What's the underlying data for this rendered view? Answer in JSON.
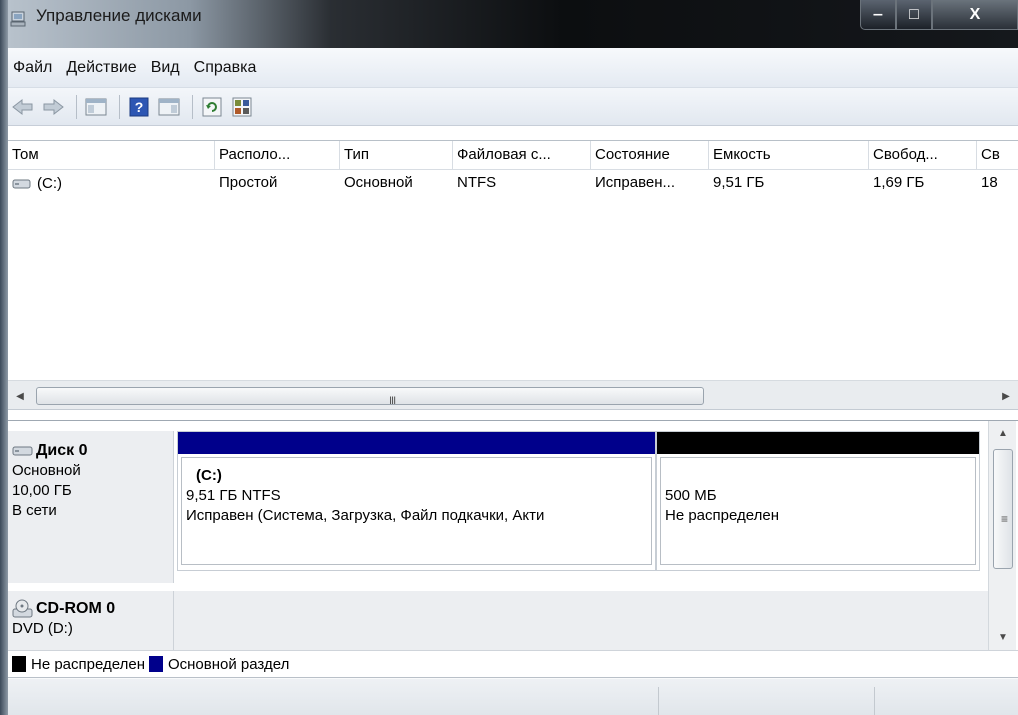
{
  "window": {
    "title": "Управление дисками",
    "minimize": "‒",
    "maximize": "□",
    "close": "X"
  },
  "menu": [
    "Файл",
    "Действие",
    "Вид",
    "Справка"
  ],
  "toolbar": {
    "icons": [
      "back-arrow-icon",
      "forward-arrow-icon",
      "console-tree-icon",
      "help-icon",
      "action-pane-icon",
      "refresh-icon",
      "properties-icon"
    ]
  },
  "volume_list": {
    "columns": [
      "Том",
      "Располо...",
      "Тип",
      "Файловая с...",
      "Состояние",
      "Емкость",
      "Свобод...",
      "Св"
    ],
    "rows": [
      [
        "(C:)",
        "Простой",
        "Основной",
        "NTFS",
        "Исправен...",
        "9,51 ГБ",
        "1,69 ГБ",
        "18"
      ]
    ]
  },
  "hscroll": {
    "grip": "III"
  },
  "disks": [
    {
      "name": "Диск 0",
      "type": "Основной",
      "size": "10,00 ГБ",
      "status": "В сети",
      "partitions": [
        {
          "label": "(C:)",
          "size": "9,51 ГБ NTFS",
          "status": "Исправен (Система, Загрузка, Файл подкачки, Акти",
          "color": "#00008b"
        },
        {
          "label": "",
          "size": "500 МБ",
          "status": "Не распределен",
          "color": "#000000"
        }
      ]
    },
    {
      "name": "CD-ROM 0",
      "type": "DVD (D:)"
    }
  ],
  "vscroll": {
    "grip": "≡"
  },
  "legend": [
    {
      "label": "Не распределен",
      "color": "#000000"
    },
    {
      "label": "Основной раздел",
      "color": "#00008b"
    }
  ]
}
